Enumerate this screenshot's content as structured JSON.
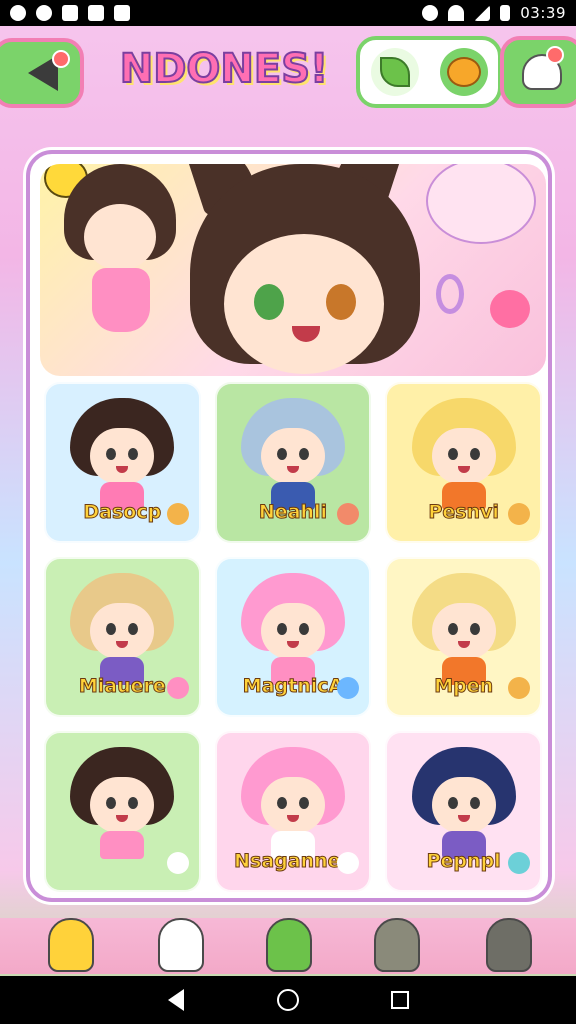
{
  "status_bar": {
    "time": "03:39",
    "left_icons": [
      "app-notification-icon",
      "whatsapp-icon",
      "image-icon",
      "mail-icon",
      "download-icon"
    ],
    "right_icons": [
      "alarm-icon",
      "wifi-icon",
      "signal-icon",
      "battery-icon"
    ]
  },
  "header": {
    "title": "NDONES!",
    "back_icon": "back-arrow-icon",
    "group_icons": [
      "leaf-icon",
      "creature-icon"
    ],
    "profile_icon": "ghost-profile-icon"
  },
  "hero": {
    "description_icons": [
      "bee-icon",
      "blob-mascot-icon",
      "heart-icon"
    ]
  },
  "characters": [
    {
      "name": "Dasocp",
      "bg": "#d8f0ff",
      "hair": "#3b2620",
      "body": "#ff7bb4",
      "deco": "#f3b34a"
    },
    {
      "name": "Neahli",
      "bg": "#b9e6a3",
      "hair": "#a9c4de",
      "body": "#3a5bb0",
      "deco": "#f28a6a"
    },
    {
      "name": "Pesnvi",
      "bg": "#fff0a8",
      "hair": "#f7d86a",
      "body": "#f2772a",
      "deco": "#f3b34a"
    },
    {
      "name": "Miauere",
      "bg": "#c9efb4",
      "hair": "#e8c98a",
      "body": "#7b5cc4",
      "deco": "#ff8fc2"
    },
    {
      "name": "MagtnicA",
      "bg": "#d5f2ff",
      "hair": "#ff9ad0",
      "body": "#ff8fc2",
      "deco": "#6cb7ff"
    },
    {
      "name": "Mpen",
      "bg": "#fff6c4",
      "hair": "#f4dc86",
      "body": "#f2772a",
      "deco": "#f3b34a"
    },
    {
      "name": "",
      "bg": "#c9efb4",
      "hair": "#3b2620",
      "body": "#ff8fc2",
      "deco": "#ffffff"
    },
    {
      "name": "Nsagannes",
      "bg": "#ffd6ec",
      "hair": "#ff9ad0",
      "body": "#ffffff",
      "deco": "#ffffff"
    },
    {
      "name": "Pepnpl",
      "bg": "#ffe1f2",
      "hair": "#27346f",
      "body": "#7b5cc4",
      "deco": "#6cd0d8"
    }
  ],
  "bottom_characters": [
    "chick-icon",
    "sheep-icon",
    "frog-icon",
    "bear-icon",
    "cat-icon"
  ],
  "nav": {
    "back": "nav-back-icon",
    "home": "nav-home-icon",
    "recent": "nav-recent-icon"
  }
}
